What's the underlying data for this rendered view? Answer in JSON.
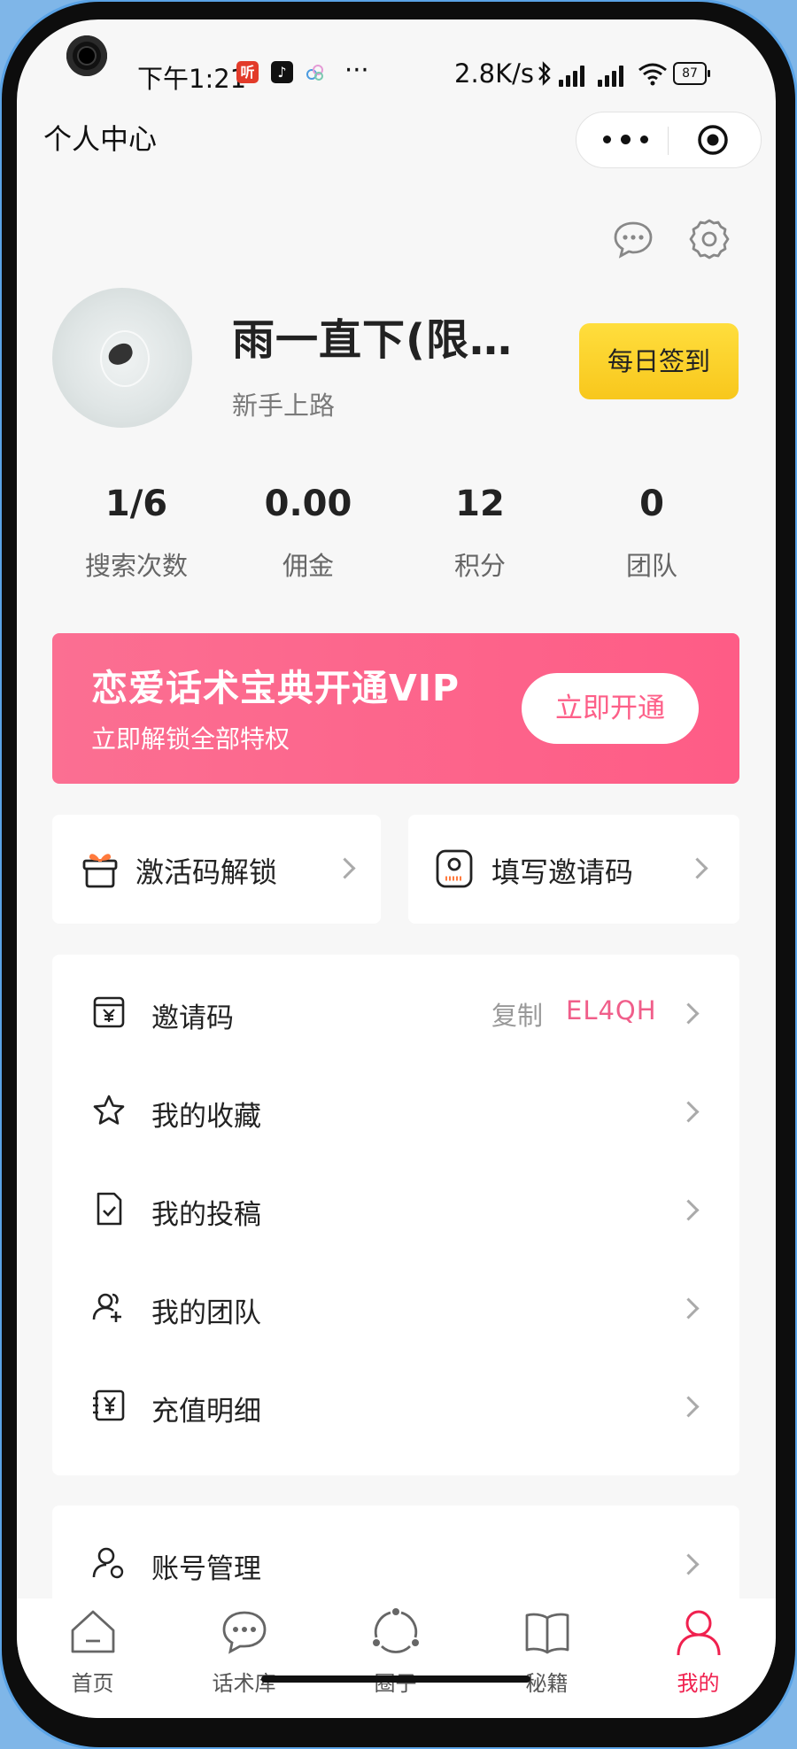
{
  "status_bar": {
    "time": "下午1:21",
    "more": "···",
    "speed": "2.8K/s",
    "battery": "87"
  },
  "header": {
    "title": "个人中心"
  },
  "profile": {
    "name": "雨一直下(限…",
    "level": "新手上路",
    "checkin_label": "每日签到"
  },
  "stats": [
    {
      "value": "1/6",
      "label": "搜索次数"
    },
    {
      "value": "0.00",
      "label": "佣金"
    },
    {
      "value": "12",
      "label": "积分"
    },
    {
      "value": "0",
      "label": "团队"
    }
  ],
  "vip": {
    "title": "恋爱话术宝典开通VIP",
    "subtitle": "立即解锁全部特权",
    "button": "立即开通"
  },
  "cards": [
    {
      "label": "激活码解锁",
      "icon": "gift-icon"
    },
    {
      "label": "填写邀请码",
      "icon": "invite-code-icon"
    }
  ],
  "menu": [
    {
      "label": "邀请码",
      "icon": "ticket-icon",
      "copy": "复制",
      "code": "EL4QH"
    },
    {
      "label": "我的收藏",
      "icon": "star-icon"
    },
    {
      "label": "我的投稿",
      "icon": "document-check-icon"
    },
    {
      "label": "我的团队",
      "icon": "team-add-icon"
    },
    {
      "label": "充值明细",
      "icon": "yuan-receipt-icon"
    }
  ],
  "menu2": [
    {
      "label": "账号管理",
      "icon": "user-manage-icon"
    }
  ],
  "tabbar": [
    {
      "label": "首页",
      "icon": "home-icon"
    },
    {
      "label": "话术库",
      "icon": "chat-icon"
    },
    {
      "label": "圈子",
      "icon": "circle-icon"
    },
    {
      "label": "秘籍",
      "icon": "book-icon"
    },
    {
      "label": "我的",
      "icon": "user-icon",
      "active": true
    }
  ],
  "colors": {
    "accent_pink": "#fe5c86",
    "checkin_yellow": "#f8c71c",
    "tab_active": "#f0214f"
  }
}
